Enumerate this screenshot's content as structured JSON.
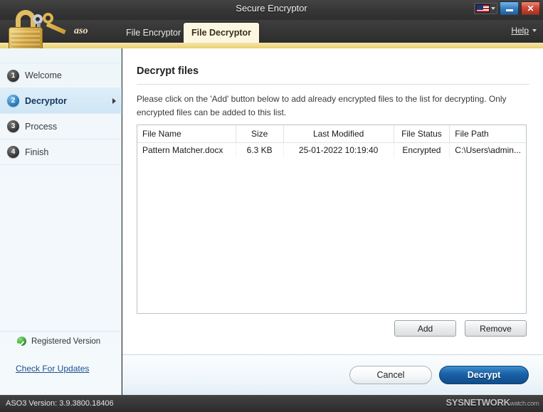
{
  "window": {
    "title": "Secure Encryptor",
    "language_flag_icon": "us-flag-icon",
    "minimize_label": "",
    "close_label": "✕"
  },
  "tabs": {
    "brand": "aso",
    "items": [
      {
        "label": "File Encryptor",
        "active": false
      },
      {
        "label": "File Decryptor",
        "active": true
      }
    ],
    "help_label": "Help"
  },
  "sidebar": {
    "steps": [
      {
        "num": "1",
        "label": "Welcome",
        "active": false
      },
      {
        "num": "2",
        "label": "Decryptor",
        "active": true
      },
      {
        "num": "3",
        "label": "Process",
        "active": false
      },
      {
        "num": "4",
        "label": "Finish",
        "active": false
      }
    ],
    "registered_label": "Registered Version",
    "registered_icon": "green-check-icon",
    "update_link": "Check For Updates"
  },
  "main": {
    "page_title": "Decrypt files",
    "description": "Please click on the 'Add' button below to add already encrypted files to the list for decrypting. Only encrypted files can be added to this list.",
    "table": {
      "columns": [
        "File Name",
        "Size",
        "Last Modified",
        "File Status",
        "File Path"
      ],
      "rows": [
        {
          "file_name": "Pattern Matcher.docx",
          "size": "6.3 KB",
          "last_modified": "25-01-2022 10:19:40",
          "file_status": "Encrypted",
          "file_path": "C:\\Users\\admin..."
        }
      ]
    },
    "add_label": "Add",
    "remove_label": "Remove"
  },
  "footer": {
    "cancel_label": "Cancel",
    "primary_label": "Decrypt"
  },
  "statusbar": {
    "version_text": "ASO3 Version: 3.9.3800.18406",
    "watermark": "SYSNETWORK",
    "watermark_sub": "watch.com"
  },
  "colors": {
    "accent_blue": "#1b62a8",
    "tab_active_bg": "#fdf7e2",
    "gold_band": "#e9cf74",
    "sidebar_bg": "#f1f7fb",
    "status_green": "#1f8a22"
  }
}
